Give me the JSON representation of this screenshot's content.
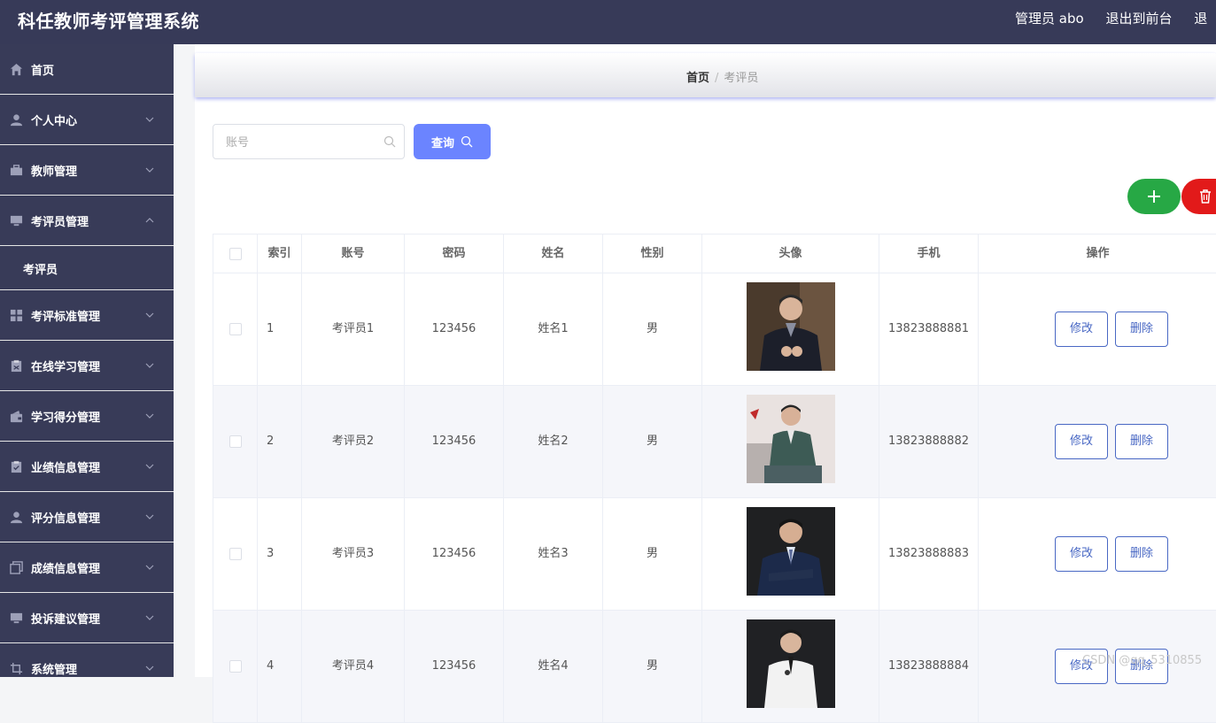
{
  "app": {
    "title": "科任教师考评管理系统"
  },
  "header": {
    "user_label": "管理员 abo",
    "exit_front": "退出到前台",
    "exit_truncated": "退"
  },
  "sidebar": {
    "items": [
      {
        "label": "首页",
        "icon": "home-icon",
        "arrow": ""
      },
      {
        "label": "个人中心",
        "icon": "user-icon",
        "arrow": "down"
      },
      {
        "label": "教师管理",
        "icon": "briefcase-icon",
        "arrow": "down"
      },
      {
        "label": "考评员管理",
        "icon": "monitor-icon",
        "arrow": "up"
      },
      {
        "label": "考评员",
        "icon": "",
        "arrow": "",
        "sub": true
      },
      {
        "label": "考评标准管理",
        "icon": "grid-icon",
        "arrow": "down"
      },
      {
        "label": "在线学习管理",
        "icon": "clipboard-icon",
        "arrow": "down"
      },
      {
        "label": "学习得分管理",
        "icon": "wallet-icon",
        "arrow": "down"
      },
      {
        "label": "业绩信息管理",
        "icon": "clipboard-check-icon",
        "arrow": "down"
      },
      {
        "label": "评分信息管理",
        "icon": "user-icon",
        "arrow": "down"
      },
      {
        "label": "成绩信息管理",
        "icon": "copy-icon",
        "arrow": "down"
      },
      {
        "label": "投诉建议管理",
        "icon": "monitor-icon",
        "arrow": "down"
      },
      {
        "label": "系统管理",
        "icon": "crop-icon",
        "arrow": "down"
      }
    ]
  },
  "breadcrumb": {
    "home": "首页",
    "separator": "/",
    "current": "考评员"
  },
  "search": {
    "placeholder": "账号",
    "query_label": "查询"
  },
  "table": {
    "headers": [
      "索引",
      "账号",
      "密码",
      "姓名",
      "性别",
      "头像",
      "手机",
      "操作"
    ],
    "rows": [
      {
        "index": "1",
        "account": "考评员1",
        "password": "123456",
        "name": "姓名1",
        "gender": "男",
        "phone": "13823888881",
        "edit": "修改",
        "delete": "删除"
      },
      {
        "index": "2",
        "account": "考评员2",
        "password": "123456",
        "name": "姓名2",
        "gender": "男",
        "phone": "13823888882",
        "edit": "修改",
        "delete": "删除"
      },
      {
        "index": "3",
        "account": "考评员3",
        "password": "123456",
        "name": "姓名3",
        "gender": "男",
        "phone": "13823888883",
        "edit": "修改",
        "delete": "删除"
      },
      {
        "index": "4",
        "account": "考评员4",
        "password": "123456",
        "name": "姓名4",
        "gender": "男",
        "phone": "13823888884",
        "edit": "修改",
        "delete": "删除"
      }
    ]
  },
  "watermark": "CSDN @qq_5310855",
  "colors": {
    "topbar": "#373a58",
    "sidebar": "#383b58",
    "query_button": "#6b84ff",
    "add_button": "#27a845",
    "delete_button": "#e21a1a",
    "op_button_border": "#4968c4"
  }
}
